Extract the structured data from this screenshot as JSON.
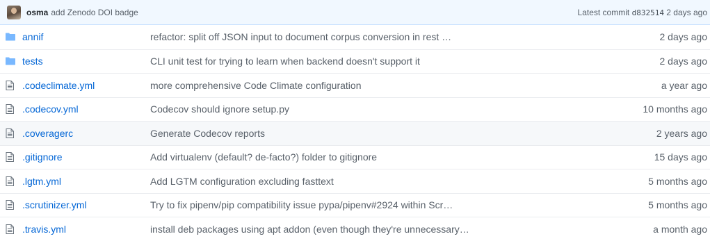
{
  "latest_commit": {
    "author": "osma",
    "message": "add Zenodo DOI badge",
    "label": "Latest commit",
    "sha": "d832514",
    "age": "2 days ago"
  },
  "files": [
    {
      "type": "directory",
      "icon": "folder-icon",
      "name": "annif",
      "message": "refactor: split off JSON input to document corpus conversion in rest …",
      "age": "2 days ago"
    },
    {
      "type": "directory",
      "icon": "folder-icon",
      "name": "tests",
      "message": "CLI unit test for trying to learn when backend doesn't support it",
      "age": "2 days ago"
    },
    {
      "type": "file",
      "icon": "file-icon",
      "name": ".codeclimate.yml",
      "message": "more comprehensive Code Climate configuration",
      "age": "a year ago"
    },
    {
      "type": "file",
      "icon": "file-icon",
      "name": ".codecov.yml",
      "message": "Codecov should ignore setup.py",
      "age": "10 months ago"
    },
    {
      "type": "file",
      "icon": "file-icon",
      "name": ".coveragerc",
      "message": "Generate Codecov reports",
      "age": "2 years ago"
    },
    {
      "type": "file",
      "icon": "file-icon",
      "name": ".gitignore",
      "message": "Add virtualenv (default? de-facto?) folder to gitignore",
      "age": "15 days ago"
    },
    {
      "type": "file",
      "icon": "file-icon",
      "name": ".lgtm.yml",
      "message": "Add LGTM configuration excluding fasttext",
      "age": "5 months ago"
    },
    {
      "type": "file",
      "icon": "file-icon",
      "name": ".scrutinizer.yml",
      "message": "Try to fix pipenv/pip compatibility issue pypa/pipenv#2924 within Scr…",
      "age": "5 months ago"
    },
    {
      "type": "file",
      "icon": "file-icon",
      "name": ".travis.yml",
      "message": "install deb packages using apt addon (even though they're unnecessary…",
      "age": "a month ago"
    }
  ],
  "colors": {
    "link": "#0366d6",
    "muted": "#586069",
    "folder": "#79b8ff",
    "file_icon": "#6a737d",
    "commit_bar_bg": "#f1f8ff",
    "highlight_row_bg": "#f6f8fa"
  },
  "highlighted_row": 4
}
